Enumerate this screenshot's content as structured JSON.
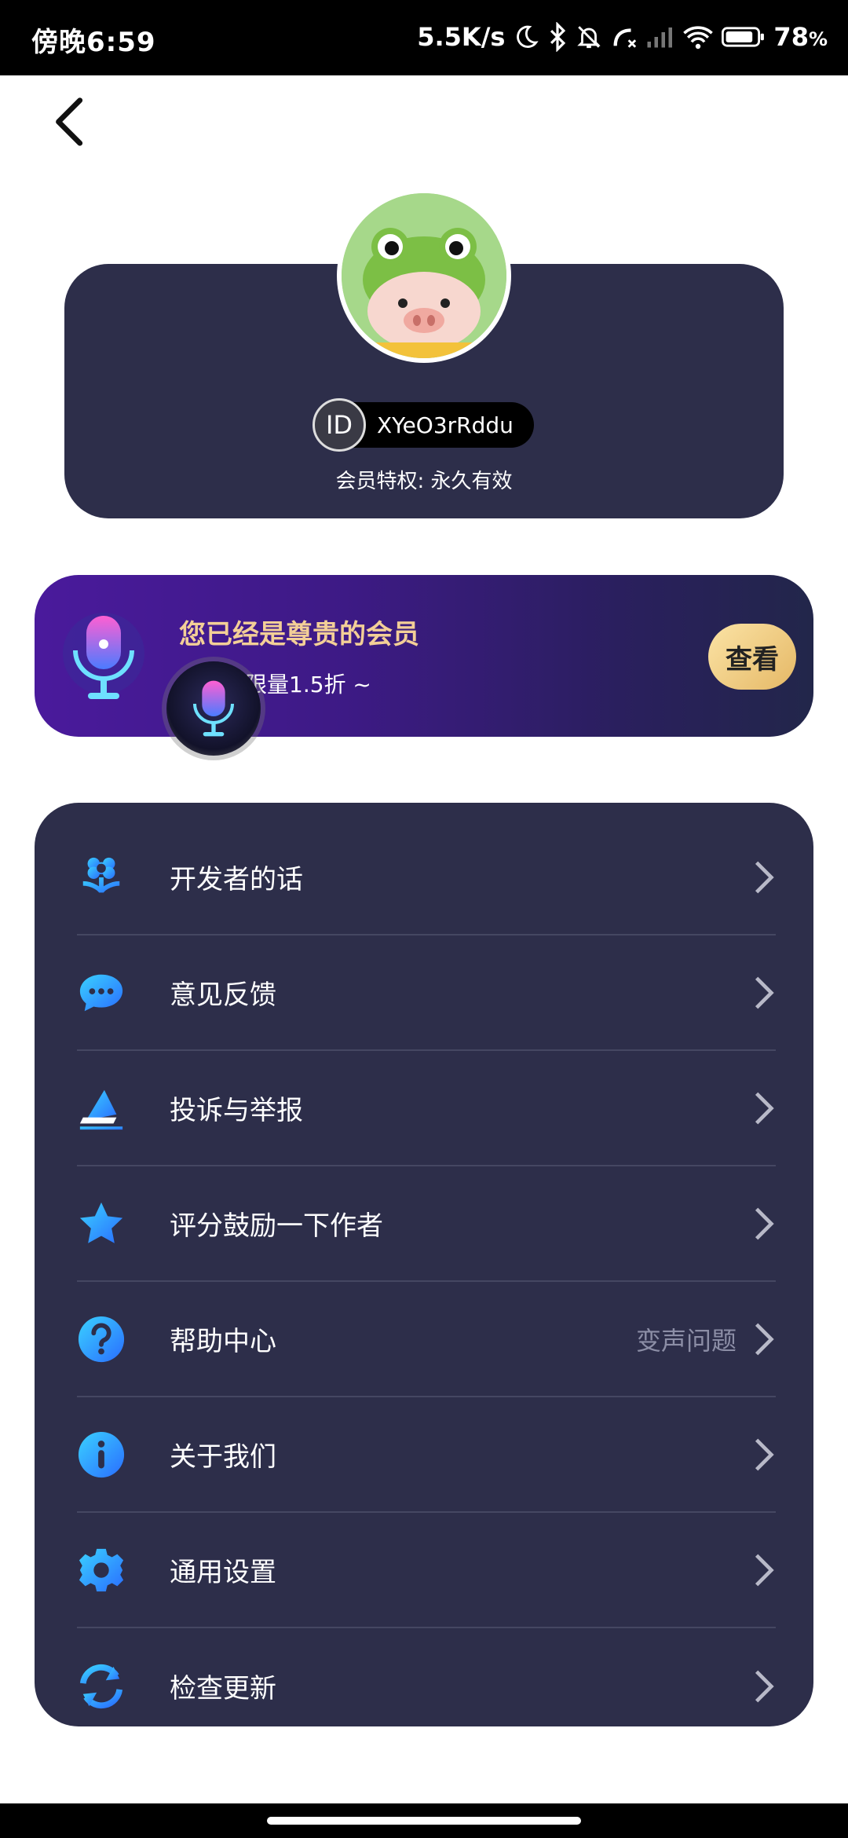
{
  "status_bar": {
    "time": "傍晚6:59",
    "net_speed": "5.5K/s",
    "battery": "78",
    "battery_unit": "%"
  },
  "profile": {
    "id_badge": "ID",
    "user_id": "XYeO3rRddu",
    "vip_validity": "会员特权: 永久有效"
  },
  "vip_banner": {
    "title": "您已经是尊贵的会员",
    "subtitle": "享会员限量1.5折 ~",
    "view_button": "查看"
  },
  "menu": {
    "items": [
      {
        "label": "开发者的话",
        "icon": "flower-icon",
        "extra": ""
      },
      {
        "label": "意见反馈",
        "icon": "chat-bubble-icon",
        "extra": ""
      },
      {
        "label": "投诉与举报",
        "icon": "report-flag-icon",
        "extra": ""
      },
      {
        "label": "评分鼓励一下作者",
        "icon": "star-icon",
        "extra": ""
      },
      {
        "label": "帮助中心",
        "icon": "help-icon",
        "extra": "变声问题"
      },
      {
        "label": "关于我们",
        "icon": "info-icon",
        "extra": ""
      },
      {
        "label": "通用设置",
        "icon": "settings-gear-icon",
        "extra": ""
      },
      {
        "label": "检查更新",
        "icon": "refresh-icon",
        "extra": ""
      }
    ]
  },
  "colors": {
    "card_bg": "#2d2e4a",
    "vip_gold": "#f3cf97",
    "icon_gradient_start": "#3ad1ff",
    "icon_gradient_end": "#2a7dff"
  }
}
